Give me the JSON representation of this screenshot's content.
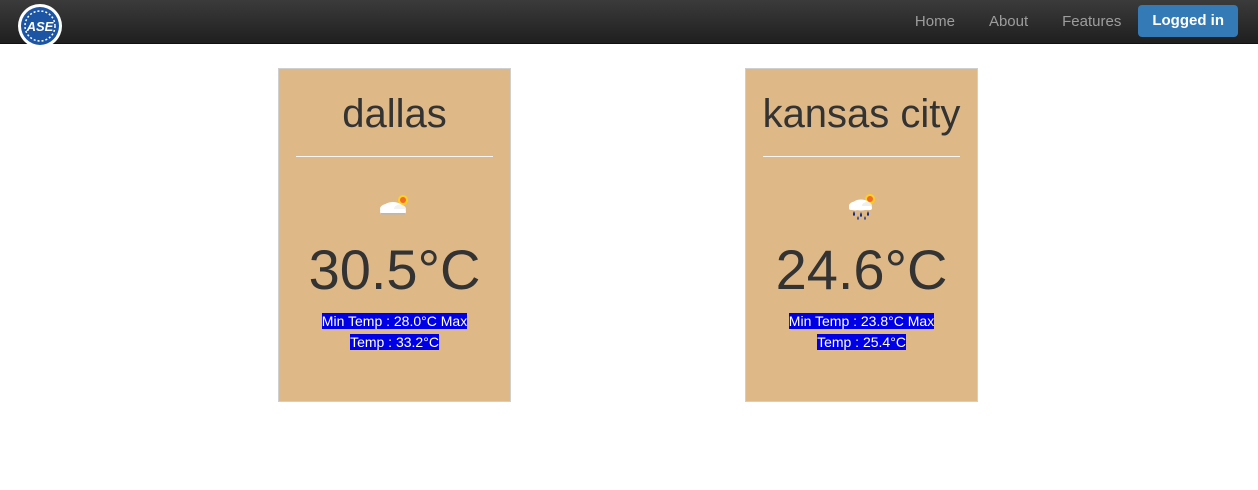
{
  "navbar": {
    "logo_text": "ASE",
    "links": [
      "Home",
      "About",
      "Features"
    ],
    "login_button": "Logged in"
  },
  "cards": [
    {
      "city": "dallas",
      "icon": "partly-cloudy-icon",
      "temp": "30.5°C",
      "minmax_line1": "Min Temp : 28.0°C Max",
      "minmax_line2": "Temp : 33.2°C"
    },
    {
      "city": "kansas city",
      "icon": "rain-cloud-icon",
      "temp": "24.6°C",
      "minmax_line1": "Min Temp : 23.8°C Max",
      "minmax_line2": "Temp : 25.4°C"
    }
  ],
  "colors": {
    "card_bg": "#deb887",
    "highlight": "#0000e6",
    "nav_button": "#337ab7"
  }
}
